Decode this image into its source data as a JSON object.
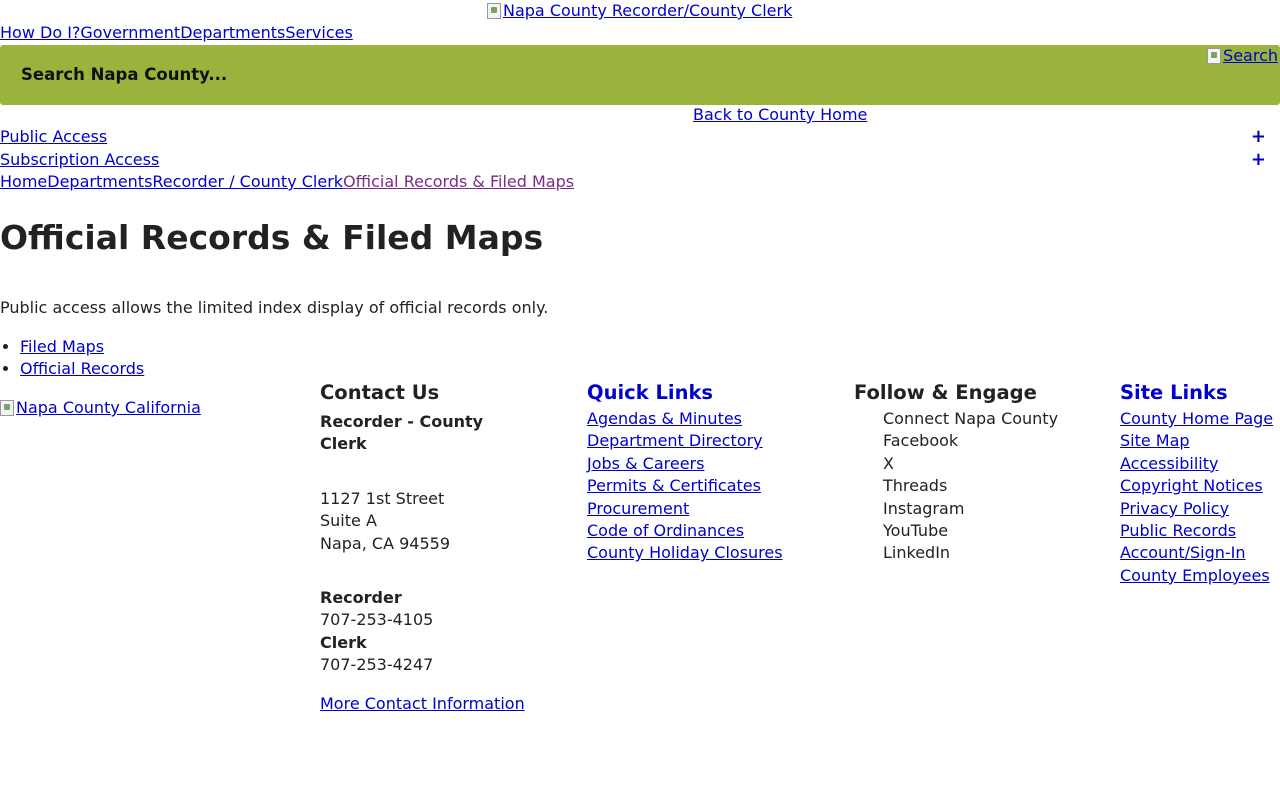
{
  "header": {
    "logo_alt": "Napa County Recorder/County Clerk",
    "nav": [
      "How Do I?",
      "Government",
      "Departments",
      "Services"
    ],
    "search_placeholder": "Search Napa County...",
    "search_button_alt": "Search",
    "back_home": "Back to County Home"
  },
  "access": {
    "public": "Public Access",
    "subscription": "Subscription Access",
    "expand_symbol": "+"
  },
  "breadcrumb": [
    "Home",
    "Departments",
    "Recorder / County Clerk",
    "Official Records & Filed Maps"
  ],
  "main": {
    "title": "Official Records & Filed Maps",
    "intro": "Public access allows the limited index display of official records only.",
    "links": [
      "Filed Maps",
      "Official Records"
    ]
  },
  "footer": {
    "logo_alt": "Napa County California",
    "contact": {
      "heading": "Contact Us",
      "office": "Recorder - County Clerk",
      "address1": "1127 1st Street",
      "address2": "Suite A",
      "address3": "Napa, CA 94559",
      "recorder_label": "Recorder",
      "recorder_phone": "707-253-4105",
      "clerk_label": "Clerk",
      "clerk_phone": "707-253-4247",
      "more": "More Contact Information"
    },
    "quick_links": {
      "heading": "Quick Links",
      "items": [
        "Agendas & Minutes",
        "Department Directory",
        "Jobs & Careers",
        "Permits & Certificates",
        "Procurement",
        "Code of Ordinances",
        "County Holiday Closures"
      ]
    },
    "follow": {
      "heading": "Follow & Engage",
      "items": [
        "Connect Napa County",
        "Facebook",
        "X",
        "Threads",
        "Instagram",
        "YouTube",
        "LinkedIn"
      ]
    },
    "site_links": {
      "heading": "Site Links",
      "items": [
        "County Home Page",
        "Site Map",
        "Accessibility",
        "Copyright Notices",
        "Privacy Policy",
        "Public Records",
        "Account/Sign-In",
        "County Employees"
      ]
    }
  }
}
